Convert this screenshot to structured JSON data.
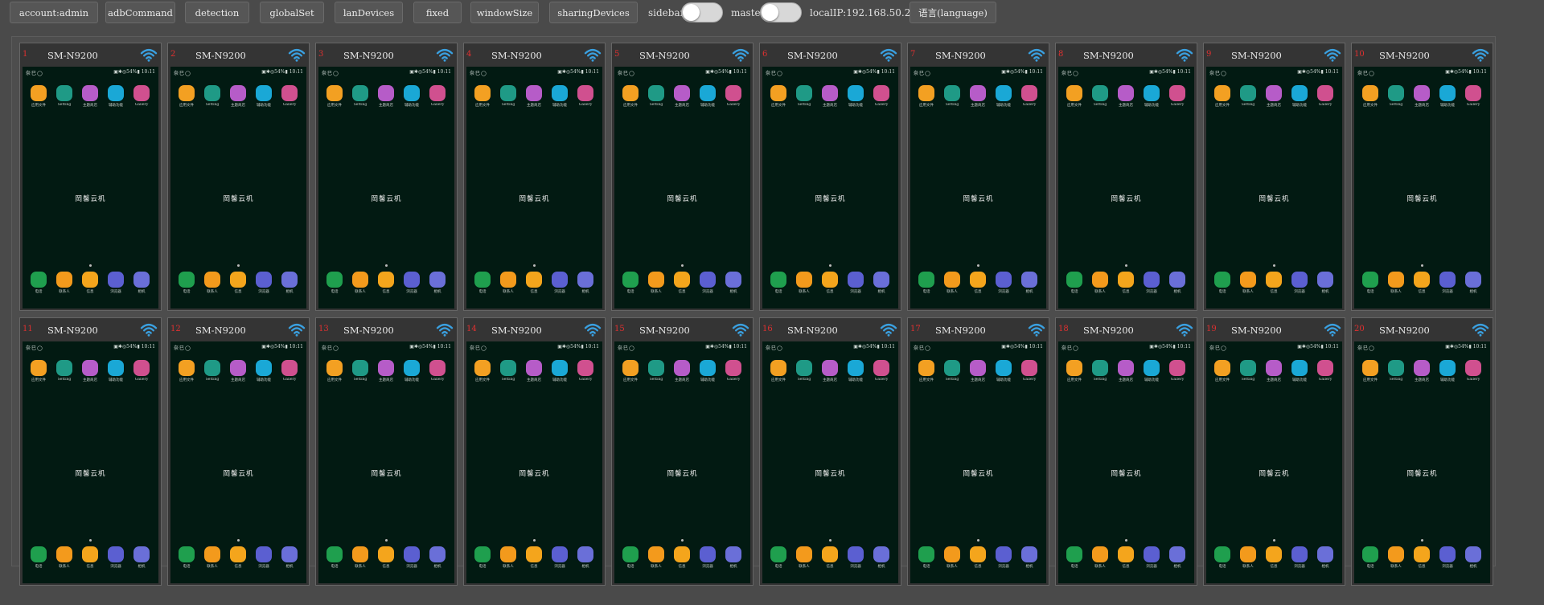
{
  "toolbar": {
    "buttons": [
      {
        "label": "account:admin"
      },
      {
        "label": "adbCommand"
      },
      {
        "label": "detection"
      },
      {
        "label": "globalSet"
      },
      {
        "label": "lanDevices"
      },
      {
        "label": "fixed"
      },
      {
        "label": "windowSize"
      },
      {
        "label": "sharingDevices"
      }
    ],
    "sidebar_label": "sidebar",
    "sidebar_on": false,
    "master_label": "master",
    "master_on": false,
    "local_ip": "localIP:192.168.50.2",
    "language_label": "语言(language)"
  },
  "device_model": "SM-N9200",
  "devices": [
    {
      "index": "1",
      "name": "SM-N9200"
    },
    {
      "index": "2",
      "name": "SM-N9200"
    },
    {
      "index": "3",
      "name": "SM-N9200"
    },
    {
      "index": "4",
      "name": "SM-N9200"
    },
    {
      "index": "5",
      "name": "SM-N9200"
    },
    {
      "index": "6",
      "name": "SM-N9200"
    },
    {
      "index": "7",
      "name": "SM-N9200"
    },
    {
      "index": "8",
      "name": "SM-N9200"
    },
    {
      "index": "9",
      "name": "SM-N9200"
    },
    {
      "index": "10",
      "name": "SM-N9200"
    },
    {
      "index": "11",
      "name": "SM-N9200"
    },
    {
      "index": "12",
      "name": "SM-N9200"
    },
    {
      "index": "13",
      "name": "SM-N9200"
    },
    {
      "index": "14",
      "name": "SM-N9200"
    },
    {
      "index": "15",
      "name": "SM-N9200"
    },
    {
      "index": "16",
      "name": "SM-N9200"
    },
    {
      "index": "17",
      "name": "SM-N9200"
    },
    {
      "index": "18",
      "name": "SM-N9200"
    },
    {
      "index": "19",
      "name": "SM-N9200"
    },
    {
      "index": "20",
      "name": "SM-N9200"
    }
  ],
  "phone_screen": {
    "status_left": "奈巳◯",
    "status_right": "▣✱◎54%▮ 10:11",
    "center_text": "岡馨云机",
    "top_apps": [
      {
        "icon": "folder-app-icon",
        "label": "应用文件",
        "color": "#f3a022"
      },
      {
        "icon": "settings-app-icon",
        "label": "Setting",
        "color": "#1f9a86"
      },
      {
        "icon": "theme-app-icon",
        "label": "主题商店",
        "color": "#b65cc8"
      },
      {
        "icon": "accessibility-app-icon",
        "label": "辅助功能",
        "color": "#1aa8d6"
      },
      {
        "icon": "gallery-app-icon",
        "label": "Gallery",
        "color": "#d0508f"
      }
    ],
    "dock_apps": [
      {
        "icon": "phone-app-icon",
        "label": "电话",
        "color": "#1f9f4e"
      },
      {
        "icon": "contacts-app-icon",
        "label": "联系人",
        "color": "#f39a1c"
      },
      {
        "icon": "messages-app-icon",
        "label": "信息",
        "color": "#f4a51c"
      },
      {
        "icon": "browser-app-icon",
        "label": "浏览器",
        "color": "#5b5fd1"
      },
      {
        "icon": "camera-app-icon",
        "label": "相机",
        "color": "#6a6fd8"
      }
    ]
  }
}
